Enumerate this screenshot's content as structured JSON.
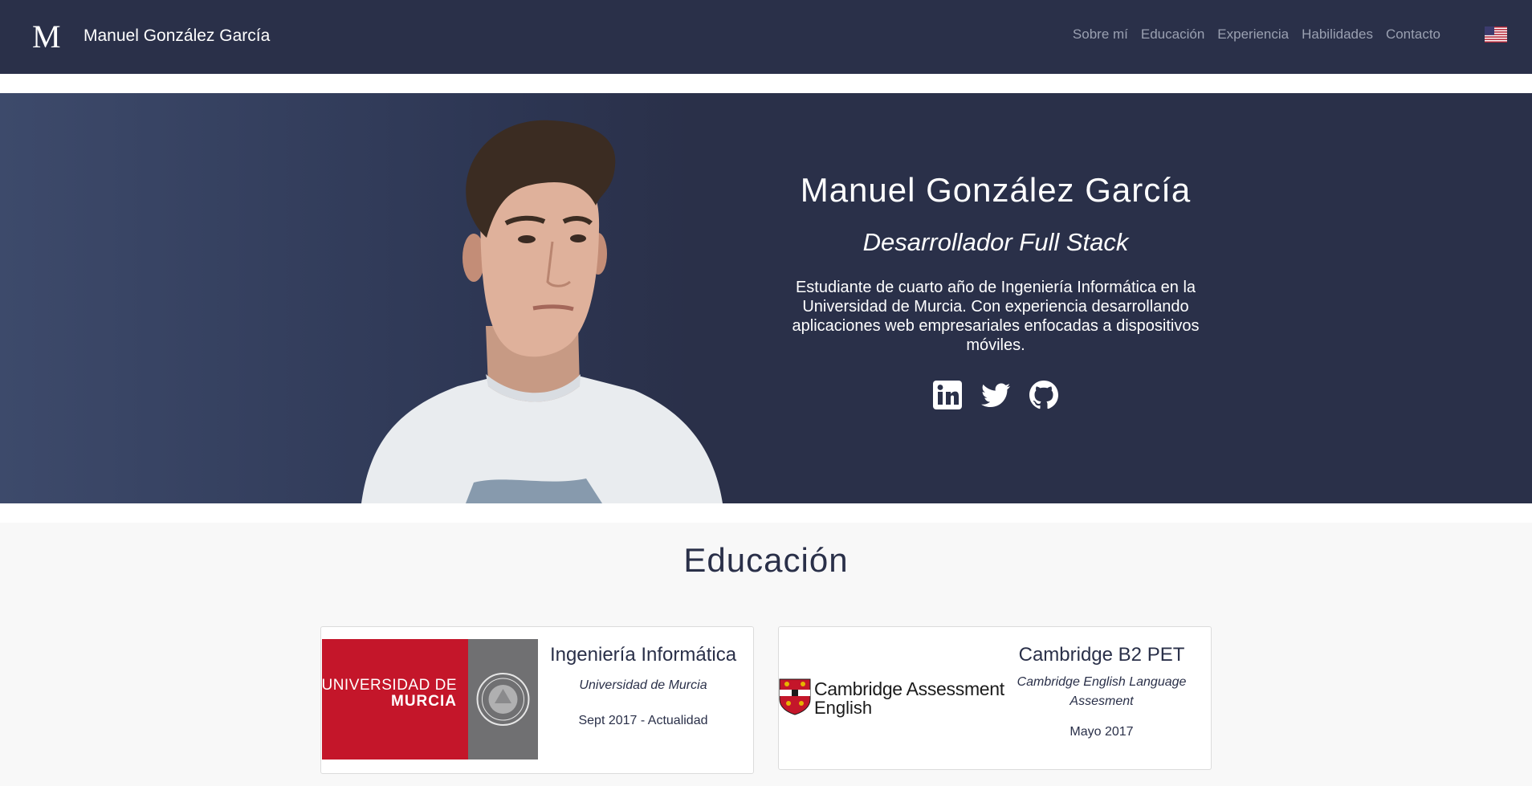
{
  "navbar": {
    "logo": "M",
    "brand": "Manuel González García",
    "links": [
      "Sobre mí",
      "Educación",
      "Experiencia",
      "Habilidades",
      "Contacto"
    ],
    "language_flag": "us-flag-icon"
  },
  "hero": {
    "name": "Manuel González García",
    "role": "Desarrollador Full Stack",
    "description": "Estudiante de cuarto año de Ingeniería Informática en la Universidad de Murcia. Con experiencia desarrollando aplicaciones web empresariales enfocadas a dispositivos móviles.",
    "socials": [
      "linkedin-icon",
      "twitter-icon",
      "github-icon"
    ]
  },
  "education": {
    "title": "Educación",
    "cards": [
      {
        "title": "Ingeniería Informática",
        "institution": "Universidad de Murcia",
        "dates": "Sept 2017 - Actualidad",
        "logo_line1": "UNIVERSIDAD DE",
        "logo_line2": "MURCIA"
      },
      {
        "title": "Cambridge B2 PET",
        "institution": "Cambridge English Language Assesment",
        "dates": "Mayo 2017",
        "logo_line1": "Cambridge Assessment",
        "logo_line2": "English"
      }
    ]
  },
  "colors": {
    "navy": "#2a3049",
    "nav_link": "#9aa0b1",
    "section_bg": "#f8f8f8",
    "um_red": "#c4162a"
  }
}
